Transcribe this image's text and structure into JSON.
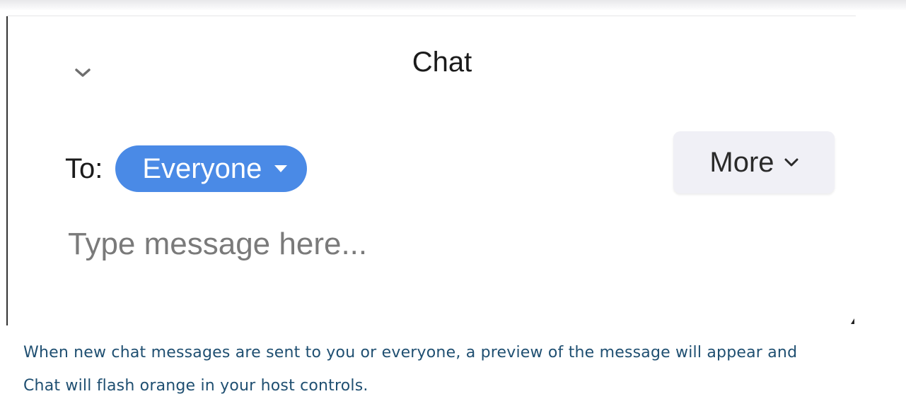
{
  "chat_panel": {
    "title": "Chat",
    "to_label": "To:",
    "recipient": "Everyone",
    "more_button_label": "More",
    "message_placeholder": "Type message here..."
  },
  "caption": {
    "line1": "When new chat messages are sent to you or everyone, a preview of the message will appear and",
    "line2": "Chat will flash orange in your host controls."
  },
  "icons": {
    "collapse": "chevron-down-icon",
    "recipient_dropdown": "caret-down-icon",
    "more_dropdown": "chevron-down-icon",
    "resize": "resize-grip-icon"
  },
  "colors": {
    "recipient_pill": "#4a8ae6",
    "more_button_bg": "#f0f0f6",
    "caption_text": "#1f4f71"
  }
}
